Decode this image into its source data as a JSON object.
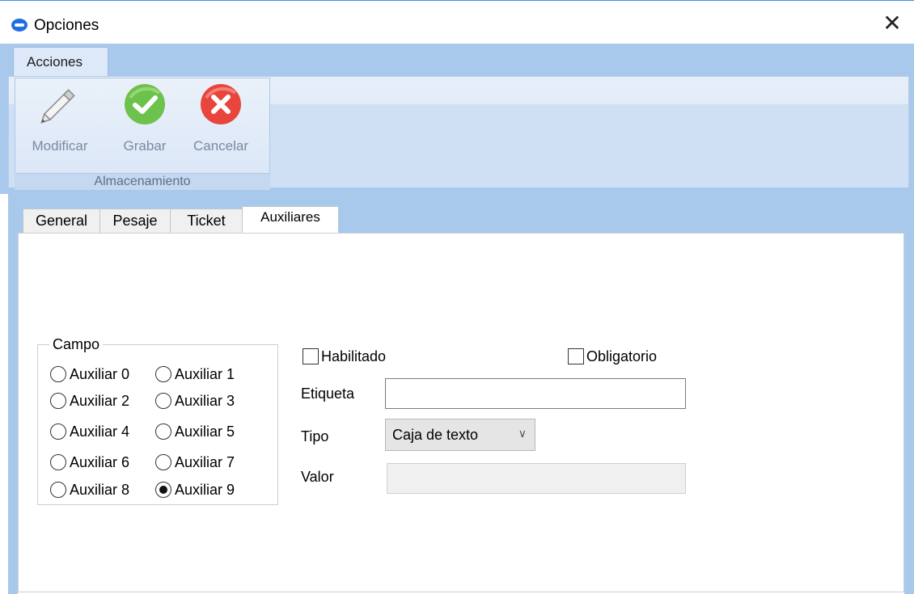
{
  "window": {
    "title": "Opciones",
    "close_glyph": "✕"
  },
  "ribbon": {
    "tab": "Acciones",
    "group_label": "Almacenamiento",
    "buttons": {
      "modificar": {
        "label": "Modificar",
        "icon": "pencil-icon"
      },
      "grabar": {
        "label": "Grabar",
        "icon": "check-circle-icon",
        "color": "#6cc24a"
      },
      "cancelar": {
        "label": "Cancelar",
        "icon": "x-circle-icon",
        "color": "#e8453c"
      }
    }
  },
  "tabs": [
    "General",
    "Pesaje",
    "Ticket",
    "Auxiliares"
  ],
  "selected_tab": "Auxiliares",
  "campo": {
    "legend": "Campo",
    "options": [
      "Auxiliar 0",
      "Auxiliar 1",
      "Auxiliar 2",
      "Auxiliar 3",
      "Auxiliar 4",
      "Auxiliar 5",
      "Auxiliar 6",
      "Auxiliar 7",
      "Auxiliar 8",
      "Auxiliar 9"
    ],
    "selected": "Auxiliar 9"
  },
  "form": {
    "habilitado": {
      "label": "Habilitado",
      "checked": false
    },
    "obligatorio": {
      "label": "Obligatorio",
      "checked": false
    },
    "etiqueta": {
      "label": "Etiqueta",
      "value": ""
    },
    "tipo": {
      "label": "Tipo",
      "value": "Caja de texto"
    },
    "valor": {
      "label": "Valor",
      "value": "",
      "enabled": false
    }
  },
  "colors": {
    "ribbon_bg": "#a8c8ec",
    "accent": "#4a8fd6"
  }
}
